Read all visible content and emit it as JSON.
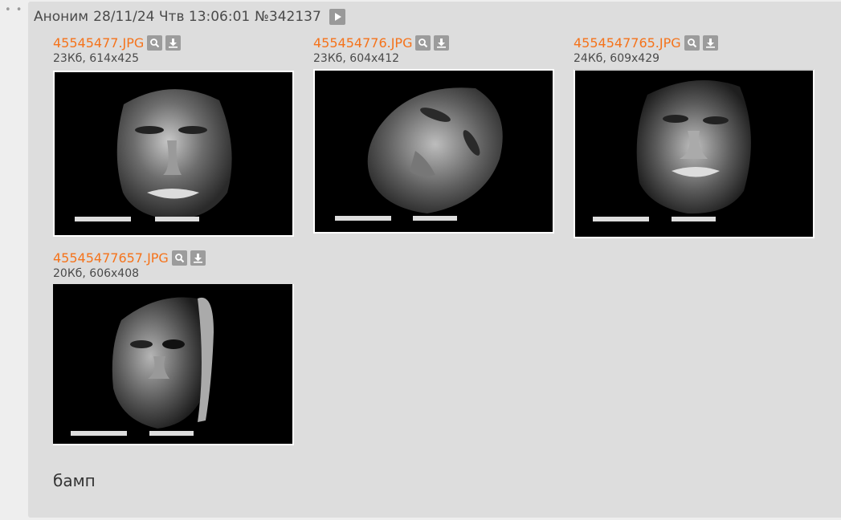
{
  "post": {
    "author": "Аноним",
    "datetime": "28/11/24 Чтв 13:06:01",
    "number": "№342137",
    "comment": "бамп"
  },
  "files": [
    {
      "name": "45545477.JPG",
      "meta": "23Кб, 614x425"
    },
    {
      "name": "455454776.JPG",
      "meta": "23Кб, 604x412"
    },
    {
      "name": "4554547765.JPG",
      "meta": "24Кб, 609x429"
    },
    {
      "name": "45545477657.JPG",
      "meta": "20Кб, 606x408"
    }
  ],
  "icons": {
    "menu": "dots-icon",
    "play": "play-icon",
    "search": "magnifier-icon",
    "download": "download-icon"
  },
  "colors": {
    "link": "#f5731b",
    "post_bg": "#dddddd",
    "page_bg": "#eeeeee"
  }
}
